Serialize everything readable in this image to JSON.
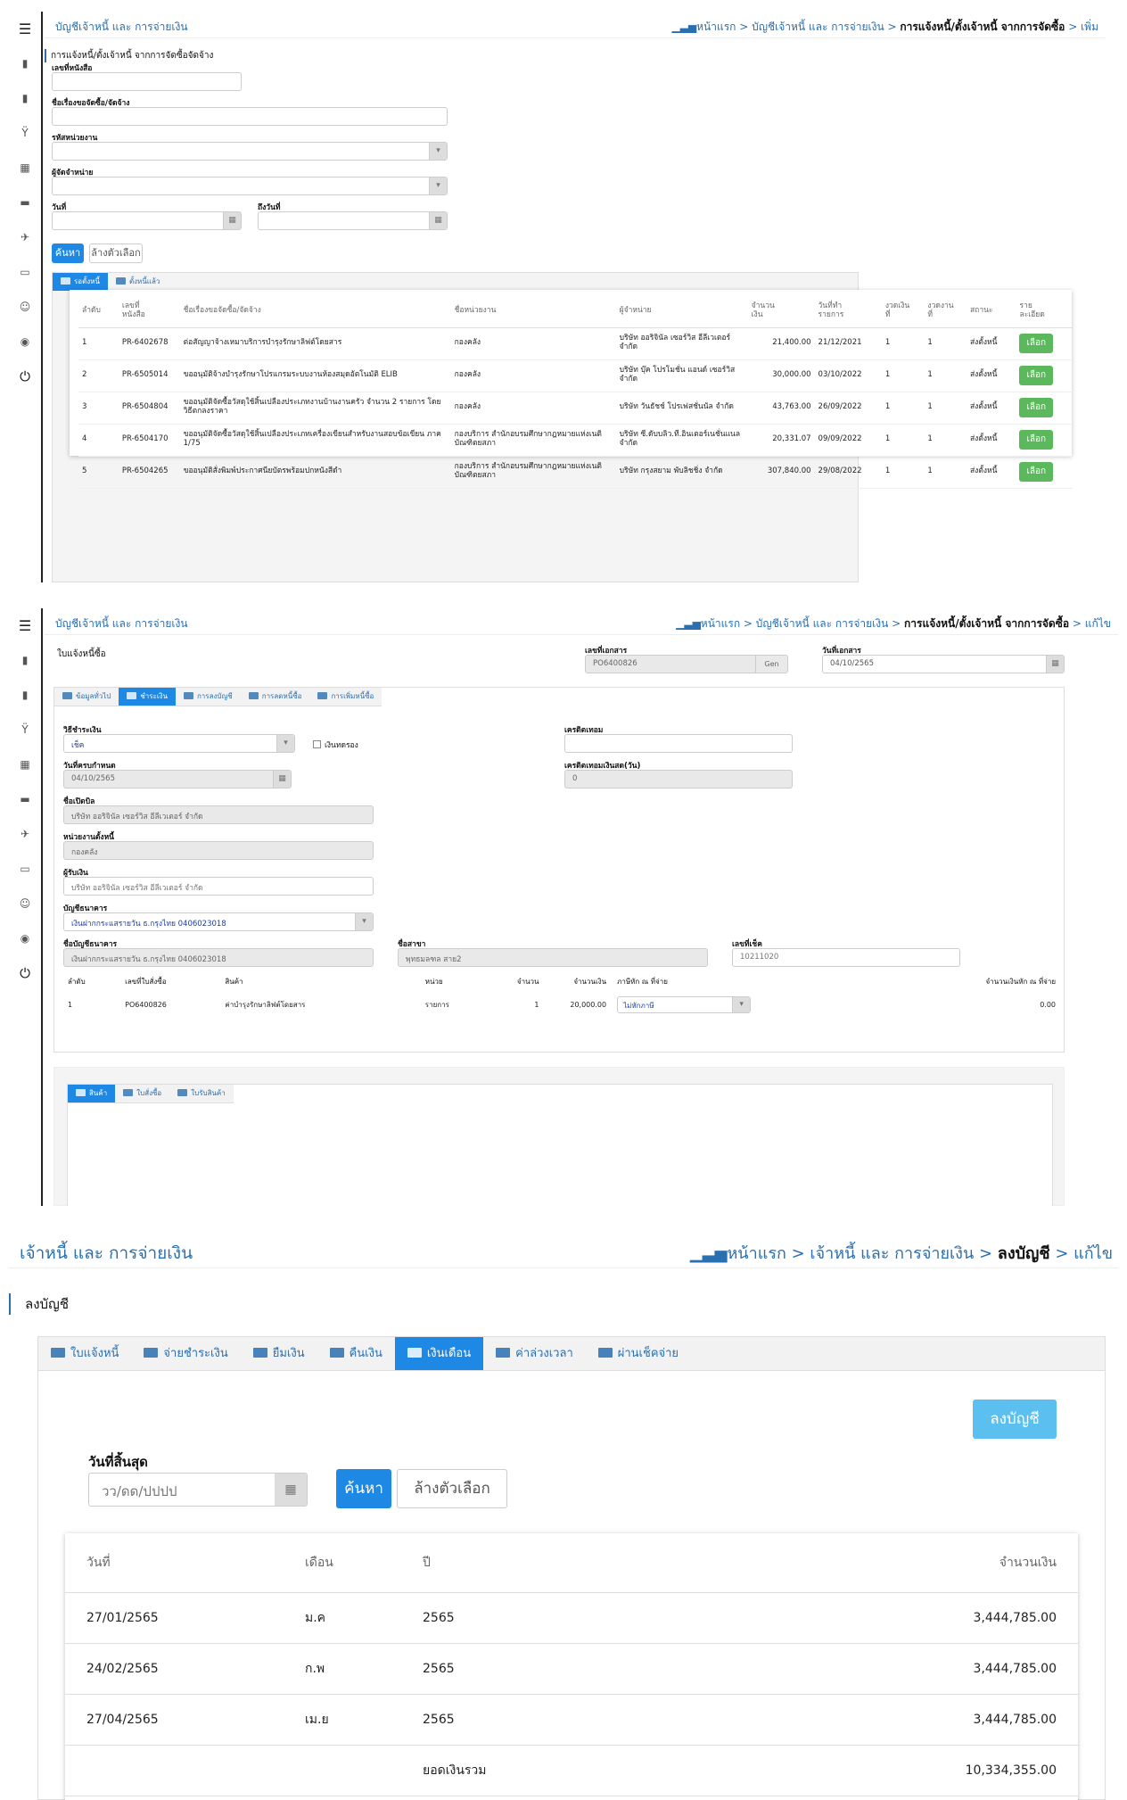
{
  "p1": {
    "module": "บัญชีเจ้าหนี้ และ การจ่ายเงิน",
    "crumb": {
      "home": "หน้าแรก",
      "c1": "บัญชีเจ้าหนี้ และ การจ่ายเงิน",
      "c2": "การแจ้งหนี้/ตั้งเจ้าหนี้ จากการจัดซื้อ",
      "c3": "เพิ่ม"
    },
    "subtitle": "การแจ้งหนี้/ตั้งเจ้าหนี้ จากการจัดซื้อจัดจ้าง",
    "labels": {
      "doc_no": "เลขที่หนังสือ",
      "subject": "ชื่อเรื่องขอจัดซื้อ/จัดจ้าง",
      "unit_code": "รหัสหน่วยงาน",
      "vendor": "ผู้จัดจำหน่าย",
      "date_from": "วันที่",
      "date_to": "ถึงวันที่"
    },
    "search": "ค้นหา",
    "clear": "ล้างตัวเลือก",
    "tabs": [
      "รอตั้งหนี้",
      "ตั้งหนี้แล้ว"
    ],
    "headers": [
      "ลำดับ",
      "เลขที่\nหนังสือ",
      "ชื่อเรื่องขอจัดซื้อ/จัดจ้าง",
      "ชื่อหน่วยงาน",
      "ผู้จำหน่าย",
      "จำนวน\nเงิน",
      "วันที่ทำ\nรายการ",
      "งวดเงิน\nที่",
      "งวดงาน\nที่",
      "สถานะ",
      "ราย\nละเอียด"
    ],
    "rows": [
      [
        "1",
        "PR-6402678",
        "ต่อสัญญาจ้างเหมาบริการบำรุงรักษาลิฟต์โดยสาร",
        "กองคลัง",
        "บริษัท ออริจินัล เซอร์วิส อีลีเวเตอร์ จำกัด",
        "21,400.00",
        "21/12/2021",
        "1",
        "1",
        "ส่งตั้งหนี้",
        "เลือก"
      ],
      [
        "2",
        "PR-6505014",
        "ขออนุมัติจ้างบำรุงรักษาโปรแกรมระบบงานห้องสมุดอัตโนมัติ ELIB",
        "กองคลัง",
        "บริษัท บุ๊ค โปรโมชั่น แอนด์ เซอร์วิส จำกัด",
        "30,000.00",
        "03/10/2022",
        "1",
        "1",
        "ส่งตั้งหนี้",
        "เลือก"
      ],
      [
        "3",
        "PR-6504804",
        "ขออนุมัติจัดซื้อวัสดุใช้สิ้นเปลืองประเภทงานบ้านงานครัว จำนวน 2 รายการ โดยวิธีตกลงราคา",
        "กองคลัง",
        "บริษัท วันธัชช์ โปรเฟสชั่นนัล จำกัด",
        "43,763.00",
        "26/09/2022",
        "1",
        "1",
        "ส่งตั้งหนี้",
        "เลือก"
      ],
      [
        "4",
        "PR-6504170",
        "ขออนุมัติจัดซื้อวัสดุใช้สิ้นเปลืองประเภทเครื่องเขียนสำหรับงานสอบข้อเขียน ภาค 1/75",
        "กองบริการ สำนักอบรมศึกษากฎหมายแห่งเนติบัณฑิตยสภา",
        "บริษัท ซี.ดับบลิว.ที.อินเตอร์เนชั่นแนล จำกัด",
        "20,331.07",
        "09/09/2022",
        "1",
        "1",
        "ส่งตั้งหนี้",
        "เลือก"
      ],
      [
        "5",
        "PR-6504265",
        "ขออนุมัติสั่งพิมพ์ประกาศนียบัตรพร้อมปกหนังสีดำ",
        "กองบริการ สำนักอบรมศึกษากฎหมายแห่งเนติบัณฑิตยสภา",
        "บริษัท กรุงสยาม พับลิชชิ่ง จำกัด",
        "307,840.00",
        "29/08/2022",
        "1",
        "1",
        "ส่งตั้งหนี้",
        "เลือก"
      ]
    ]
  },
  "p2": {
    "module": "บัญชีเจ้าหนี้ และ การจ่ายเงิน",
    "crumb": {
      "home": "หน้าแรก",
      "c1": "บัญชีเจ้าหนี้ และ การจ่ายเงิน",
      "c2": "การแจ้งหนี้/ตั้งเจ้าหนี้ จากการจัดซื้อ",
      "c3": "แก้ไข"
    },
    "subtitle": "ใบแจ้งหนี้ซื้อ",
    "doc_no_label": "เลขที่เอกสาร",
    "doc_no": "PO6400826",
    "gen": "Gen",
    "doc_date_label": "วันที่เอกสาร",
    "doc_date": "04/10/2565",
    "tabs": [
      "ข้อมูลทั่วไป",
      "ชำระเงิน",
      "การลงบัญชี",
      "การลดหนี้ซื้อ",
      "การเพิ่มหนี้ซื้อ"
    ],
    "pay_method_label": "วิธีชำระเงิน",
    "pay_method": "เช็ค",
    "advance": "เงินทดรอง",
    "credit_label": "เครดิตเทอม",
    "credit": "",
    "due_label": "วันที่ครบกำหนด",
    "due": "04/10/2565",
    "credit_days_label": "เครดิตเทอมเงินสด(วัน)",
    "credit_days": "0",
    "open_name_label": "ชื่อเปิดบิล",
    "open_name": "บริษัท ออริจินัล เซอร์วิส อีลีเวเตอร์ จำกัด",
    "unit_label": "หน่วยงานตั้งหนี้",
    "unit": "กองคลัง",
    "payee_label": "ผู้รับเงิน",
    "payee": "บริษัท ออริจินัล เซอร์วิส อีลีเวเตอร์ จำกัด",
    "bank_acc_label": "บัญชีธนาคาร",
    "bank_acc": "เงินฝากกระแสรายวัน ธ.กรุงไทย 0406023018",
    "bank_name_label": "ชื่อบัญชีธนาคาร",
    "bank_name": "เงินฝากกระแสรายวัน ธ.กรุงไทย 0406023018",
    "branch_label": "ชื่อสาขา",
    "branch": "พุทธมลฑล สาย2",
    "cheque_label": "เลขที่เช็ค",
    "cheque": "10211020",
    "tabs2": [
      "สินค้า",
      "ใบสั่งซื้อ",
      "ใบรับสินค้า"
    ],
    "headers": [
      "ลำดับ",
      "เลขที่ใบสั่งซื้อ",
      "สินค้า",
      "หน่วย",
      "จำนวน",
      "จำนวนเงิน",
      "ภาษีหัก ณ ที่จ่าย",
      "จำนวนเงินหัก ณ ที่จ่าย"
    ],
    "row": [
      "1",
      "PO6400826",
      "ค่าบำรุงรักษาลิฟต์โดยสาร",
      "รายการ",
      "1",
      "20,000.00",
      "ไม่หักภาษี",
      "0.00"
    ]
  },
  "p3": {
    "module": "เจ้าหนี้ และ การจ่ายเงิน",
    "crumb": {
      "home": "หน้าแรก",
      "c1": "เจ้าหนี้ และ การจ่ายเงิน",
      "c2": "ลงบัญชี",
      "c3": "แก้ไข"
    },
    "subtitle": "ลงบัญชี",
    "tabs": [
      "ใบแจ้งหนี้",
      "จ่ายชำระเงิน",
      "ยืมเงิน",
      "คืนเงิน",
      "เงินเดือน",
      "ค่าล่วงเวลา",
      "ผ่านเช็คจ่าย"
    ],
    "post_btn": "ลงบัญชี",
    "end_date_label": "วันที่สิ้นสุด",
    "end_date_ph": "วว/ดด/ปปปป",
    "search": "ค้นหา",
    "clear": "ล้างตัวเลือก",
    "headers": [
      "วันที่",
      "เดือน",
      "ปี",
      "จำนวนเงิน"
    ],
    "rows": [
      [
        "27/01/2565",
        "ม.ค",
        "2565",
        "3,444,785.00"
      ],
      [
        "24/02/2565",
        "ก.พ",
        "2565",
        "3,444,785.00"
      ],
      [
        "27/04/2565",
        "เม.ย",
        "2565",
        "3,444,785.00"
      ]
    ],
    "total_label": "ยอดเงินรวม",
    "total": "10,334,355.00"
  }
}
